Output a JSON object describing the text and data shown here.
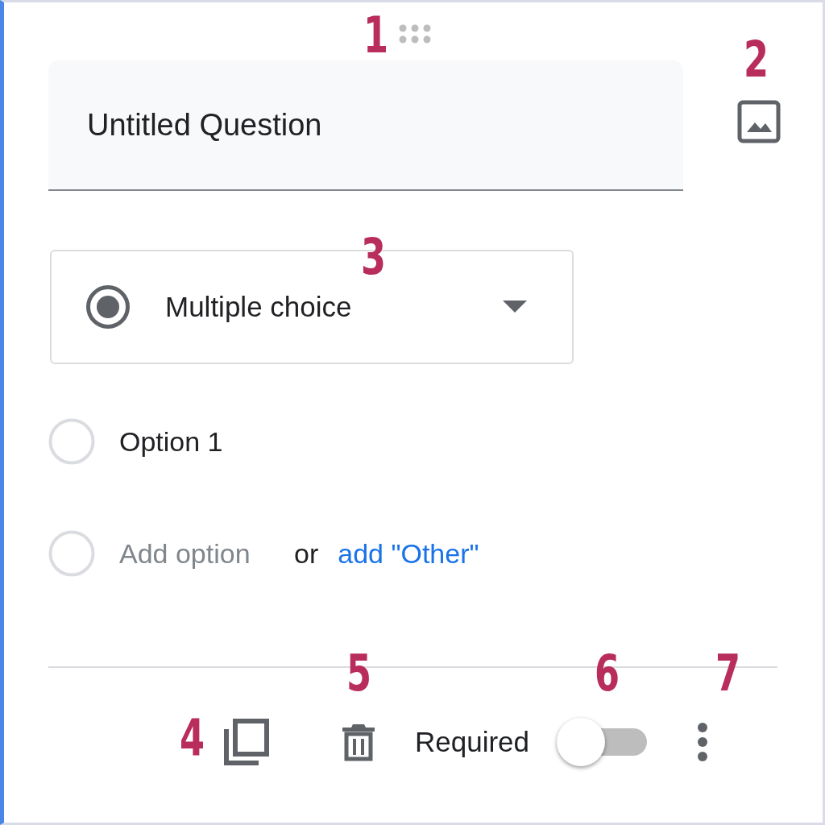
{
  "question": {
    "marker": "1",
    "title": "Untitled Question"
  },
  "image_button": {
    "marker": "2"
  },
  "type_dropdown": {
    "marker": "3",
    "value": "Multiple choice"
  },
  "options": [
    {
      "label": "Option 1",
      "checked": false
    }
  ],
  "add_option": {
    "checked": false,
    "placeholder": "Add option",
    "or": "or",
    "other_link": "add \"Other\""
  },
  "footer": {
    "duplicate_marker": "4",
    "delete_marker": "5",
    "required_marker": "6",
    "more_marker": "7",
    "required_label": "Required",
    "required_on": false
  }
}
